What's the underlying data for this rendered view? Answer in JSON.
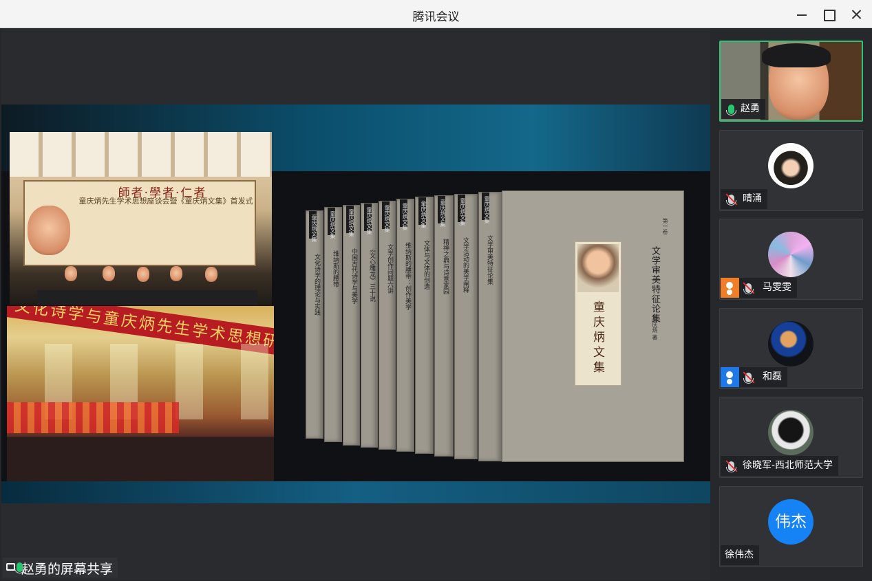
{
  "window": {
    "title": "腾讯会议"
  },
  "share": {
    "label": "赵勇的屏幕共享"
  },
  "slide": {
    "photo1": {
      "motto": "師者·學者·仁者",
      "headline": "童庆炳先生学术思想座谈会暨《童庆炳文集》首发式"
    },
    "photo2": {
      "banner": "文化诗学与童庆炳先生学术思想研讨会"
    },
    "books": {
      "series_title": "童庆炳文集",
      "volume": "第一卷",
      "cover_subtitle": "文学审美特征论集",
      "author": "童庆炳 著",
      "spines": [
        "文化诗学的理论与实践",
        "维纳斯的腰带",
        "中国古代诗学与美学",
        "《文心雕龙》三十说",
        "文学创作问题六讲",
        "维纳斯的腰带：创作美学",
        "文体与文体的创造",
        "精神之鼎与诗意家园",
        "文学活动的美学阐释",
        "文学审美特征论集"
      ]
    },
    "controls": [
      "previous-icon",
      "next-icon",
      "pen-icon",
      "copy-icon",
      "zoom-icon",
      "more-icon"
    ]
  },
  "participants": [
    {
      "name": "赵勇",
      "status": "speaking",
      "tile": "video"
    },
    {
      "name": "晴涌",
      "status": "muted",
      "tile": "avatar"
    },
    {
      "name": "马雯雯",
      "status": "muted-host",
      "tile": "avatar"
    },
    {
      "name": "和磊",
      "status": "muted-blue",
      "tile": "avatar"
    },
    {
      "name": "徐晓军-西北师范大学",
      "status": "muted",
      "tile": "avatar"
    },
    {
      "name": "徐伟杰",
      "status": "none",
      "tile": "initials",
      "initials": "伟杰"
    }
  ]
}
